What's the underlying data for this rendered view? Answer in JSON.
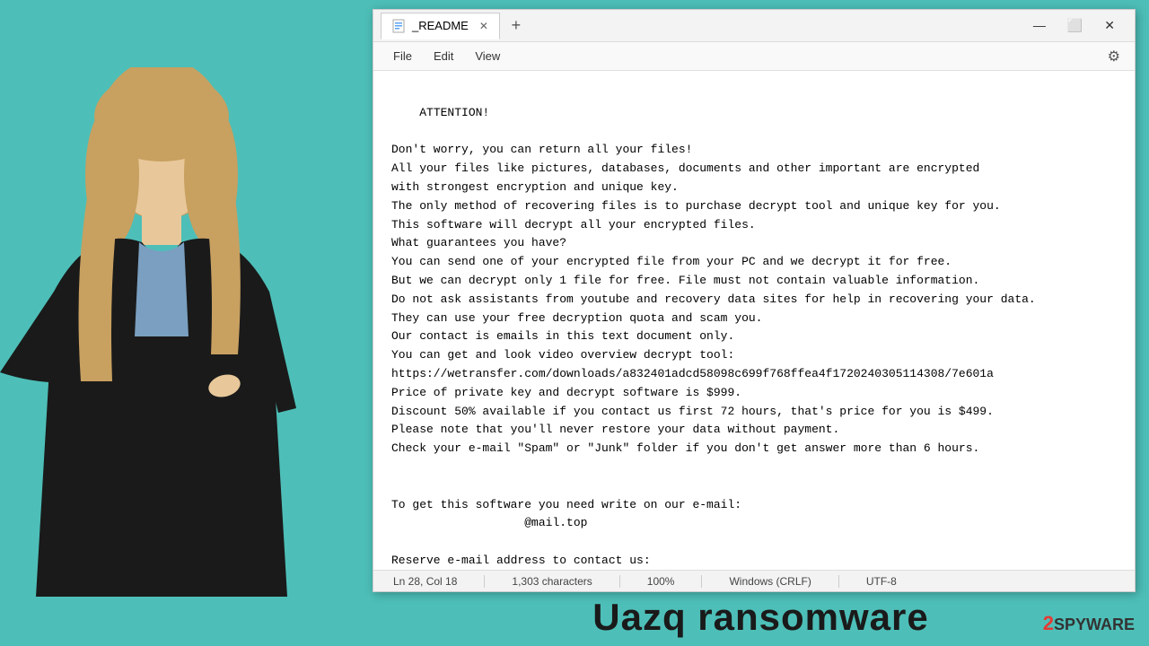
{
  "window": {
    "tab_title": "_README",
    "tab_icon": "notepad-icon",
    "new_tab_label": "+",
    "controls": {
      "minimize": "—",
      "maximize": "⬜",
      "close": "✕"
    }
  },
  "menubar": {
    "items": [
      "File",
      "Edit",
      "View"
    ],
    "settings_icon": "⚙"
  },
  "content": {
    "text": "ATTENTION!\n\nDon't worry, you can return all your files!\nAll your files like pictures, databases, documents and other important are encrypted\nwith strongest encryption and unique key.\nThe only method of recovering files is to purchase decrypt tool and unique key for you.\nThis software will decrypt all your encrypted files.\nWhat guarantees you have?\nYou can send one of your encrypted file from your PC and we decrypt it for free.\nBut we can decrypt only 1 file for free. File must not contain valuable information.\nDo not ask assistants from youtube and recovery data sites for help in recovering your data.\nThey can use your free decryption quota and scam you.\nOur contact is emails in this text document only.\nYou can get and look video overview decrypt tool:\nhttps://wetransfer.com/downloads/a832401adcd58098c699f768ffea4f1720240305114308/7e601a\nPrice of private key and decrypt software is $999.\nDiscount 50% available if you contact us first 72 hours, that's price for you is $499.\nPlease note that you'll never restore your data without payment.\nCheck your e-mail \"Spam\" or \"Junk\" folder if you don't get answer more than 6 hours.\n\n\nTo get this software you need write on our e-mail:\n                   @mail.top\n\nReserve e-mail address to contact us:\ndatarestorehelpyou@airmail.cc\n\nYour personal ID:"
  },
  "statusbar": {
    "position": "Ln 28, Col 18",
    "characters": "1,303 characters",
    "zoom": "100%",
    "line_ending": "Windows (CRLF)",
    "encoding": "UTF-8"
  },
  "caption": {
    "title": "Uazq ransomware"
  },
  "brand": {
    "label": "2SPYWARE",
    "prefix": "2"
  }
}
